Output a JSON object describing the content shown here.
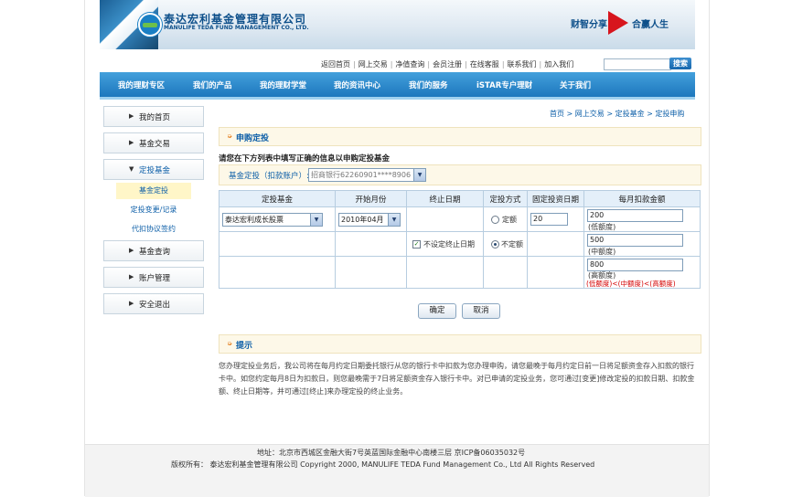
{
  "header": {
    "company_cn": "泰达宏利基金管理有限公司",
    "company_en": "MANULIFE TEDA FUND MANAGEMENT CO., LTD.",
    "slogan_left": "财智分享",
    "slogan_right": "合赢人生"
  },
  "toplinks": [
    "返回首页",
    "网上交易",
    "净值查询",
    "会员注册",
    "在线客服",
    "联系我们",
    "加入我们"
  ],
  "search": {
    "value": "",
    "button": "搜索"
  },
  "nav": [
    "我的理财专区",
    "我们的产品",
    "我的理财学堂",
    "我的资讯中心",
    "我们的服务",
    "iSTAR专户理财",
    "关于我们"
  ],
  "sidebar": {
    "items": [
      "我的首页",
      "基金交易",
      "定投基金",
      "基金查询",
      "账户管理",
      "安全退出"
    ],
    "expanded_arrow": "▼",
    "collapsed_arrow": "▶",
    "subitems": [
      "基金定投",
      "定投变更/记录",
      "代扣协议签约"
    ]
  },
  "breadcrumb": [
    "首页",
    "网上交易",
    "定投基金",
    "定投申购"
  ],
  "breadcrumb_sep": ">",
  "section1": {
    "title": "申购定投"
  },
  "instruction": "请您在下方列表中填写正确的信息以申购定投基金",
  "account": {
    "label": "基金定投（扣款账户）:",
    "value": "招商银行62260901****8906"
  },
  "table": {
    "headers": [
      "定投基金",
      "开始月份",
      "终止日期",
      "定投方式",
      "固定投资日期",
      "每月扣款金额"
    ],
    "fund": "泰达宏利成长股票",
    "start_month": "2010年04月",
    "no_end_label": "不设定终止日期",
    "mode_fixed": "定额",
    "mode_variable": "不定额",
    "day": "20",
    "amounts": [
      {
        "value": "200",
        "label": "(低额度)"
      },
      {
        "value": "500",
        "label": "(中额度)"
      },
      {
        "value": "800",
        "label": "(高额度)"
      }
    ],
    "constraint": "(低额度)<(中额度)<(高额度)"
  },
  "buttons": {
    "confirm": "确定",
    "cancel": "取消"
  },
  "section2": {
    "title": "提示"
  },
  "tip_text": "您办理定投业务后，我公司将在每月约定日期委托银行从您的银行卡中扣款为您办理申购，请您最晚于每月约定日前一日将足额资金存入扣款的银行卡中。如您约定每月8日为扣款日，则您最晚需于7日将足额资金存入银行卡中。对已申请的定投业务，您可通过[变更]修改定投的扣款日期、扣款金额、终止日期等，并可通过[终止]来办理定投的终止业务。",
  "footer": {
    "address": "地址：北京市西城区金融大街7号英蓝国际金融中心南楼三层  京ICP备06035032号",
    "copyright": "版权所有：  泰达宏利基金管理有限公司  Copyright 2000, MANULIFE TEDA Fund Management Co., Ltd All Rights Reserved"
  },
  "colors": {
    "brand_blue": "#1d77bd",
    "link_blue": "#0d5fa8",
    "alert_red": "#d40000",
    "accent_red": "#d7151d"
  }
}
